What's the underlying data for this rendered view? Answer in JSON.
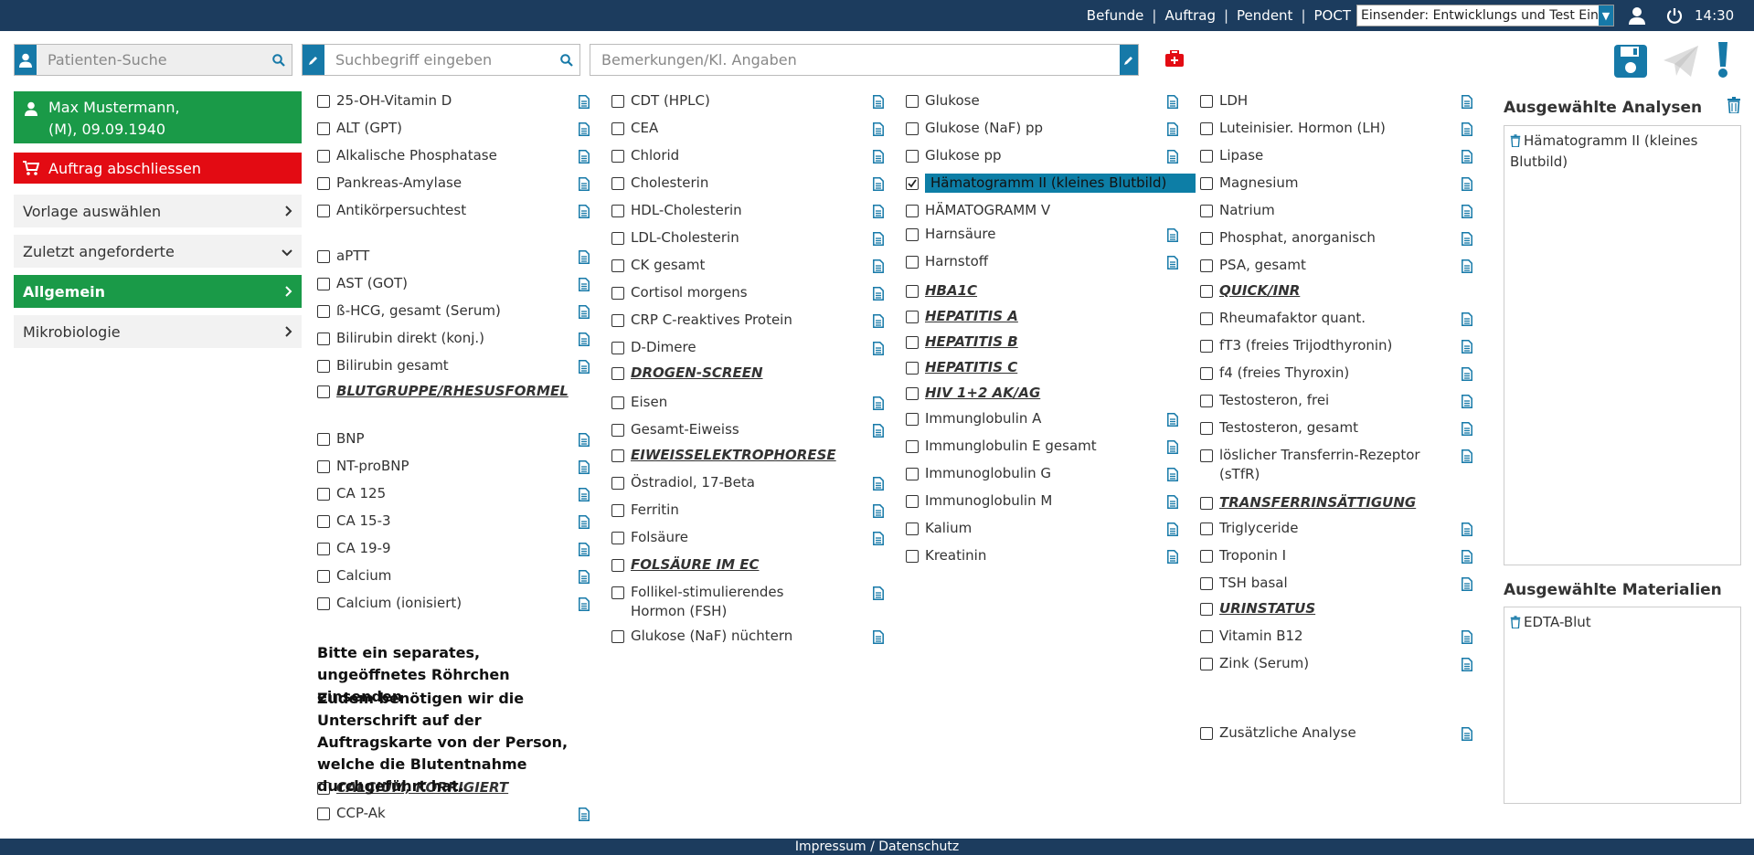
{
  "topbar": {
    "links": [
      "Befunde",
      "Auftrag",
      "Pendent",
      "POCT"
    ],
    "einsender": "Einsender: Entwicklungs und Test Einsender",
    "time": "14:30"
  },
  "search": {
    "patient_placeholder": "Patienten-Suche",
    "term_placeholder": "Suchbegriff eingeben",
    "remarks_placeholder": "Bemerkungen/Kl. Angaben"
  },
  "patient": {
    "name": "Max Mustermann,",
    "details": "(M), 09.09.1940"
  },
  "left_menu": {
    "complete_order": "Auftrag abschliessen",
    "items": [
      "Vorlage auswählen",
      "Zuletzt angeforderte",
      "Allgemein",
      "Mikrobiologie"
    ]
  },
  "columns": {
    "col1": {
      "rows": [
        "25-OH-Vitamin D",
        "ALT (GPT)",
        "Alkalische Phosphatase",
        "Pankreas-Amylase",
        "Antikörpersuchtest",
        "aPTT",
        "AST (GOT)",
        "ß-HCG, gesamt (Serum)",
        "Bilirubin direkt (konj.)",
        "Bilirubin gesamt",
        "BLUTGRUPPE/RHESUSFORMEL",
        "BNP",
        "NT-proBNP",
        "CA 125",
        "CA 15-3",
        "CA 19-9",
        "Calcium",
        "Calcium (ionisiert)",
        "CALCIUM, KORRIGIERT",
        "CCP-Ak"
      ],
      "note1": "Bitte ein separates, ungeöffnetes Röhrchen einsenden",
      "note2": "Zudem benötigen wir die Unterschrift auf der Auftragskarte von der Person, welche die Blutentnahme durchgeführt hat."
    },
    "col2": {
      "rows": [
        "CDT (HPLC)",
        "CEA",
        "Chlorid",
        "Cholesterin",
        "HDL-Cholesterin",
        "LDL-Cholesterin",
        "CK gesamt",
        "Cortisol morgens",
        "CRP C-reaktives Protein",
        "D-Dimere",
        "DROGEN-SCREEN",
        "Eisen",
        "Gesamt-Eiweiss",
        "EIWEISSELEKTROPHORESE",
        "Östradiol, 17-Beta",
        "Ferritin",
        "Folsäure",
        "FOLSÄURE IM EC",
        "Follikel-stimulierendes Hormon (FSH)",
        "Glukose (NaF) nüchtern"
      ]
    },
    "col3": {
      "rows": [
        "Glukose",
        "Glukose (NaF) pp",
        "Glukose pp",
        "Hämatogramm II (kleines Blutbild)",
        "HÄMATOGRAMM V",
        "Harnsäure",
        "Harnstoff",
        "HBA1C",
        "HEPATITIS A",
        "HEPATITIS B",
        "HEPATITIS C",
        "HIV 1+2 AK/AG",
        "Immunglobulin A",
        "Immunglobulin E gesamt",
        "Immunoglobulin G",
        "Immunoglobulin M",
        "Kalium",
        "Kreatinin"
      ]
    },
    "col4": {
      "rows": [
        "LDH",
        "Luteinisier. Hormon (LH)",
        "Lipase",
        "Magnesium",
        "Natrium",
        "Phosphat, anorganisch",
        "PSA, gesamt",
        "QUICK/INR",
        "Rheumafaktor quant.",
        "fT3 (freies Trijodthyronin)",
        "f4 (freies Thyroxin)",
        "Testosteron, frei",
        "Testosteron, gesamt",
        "löslicher Transferrin-Rezeptor (sTfR)",
        "TRANSFERRINSÄTTIGUNG",
        "Triglyceride",
        "Troponin I",
        "TSH basal",
        "URINSTATUS",
        "Vitamin B12",
        "Zink (Serum)",
        "Zusätzliche Analyse"
      ]
    }
  },
  "right": {
    "analyses_title": "Ausgewählte Analysen",
    "analyses_items": [
      "Hämatogramm II (kleines Blutbild)"
    ],
    "materials_title": "Ausgewählte Materialien",
    "materials_items": [
      "EDTA-Blut"
    ]
  },
  "footer": "Impressum / Datenschutz",
  "colors": {
    "navy": "#1c3c5e",
    "blue": "#1679a8",
    "green": "#1a9a48",
    "red": "#e30b13",
    "selected": "#0d7ea6"
  }
}
